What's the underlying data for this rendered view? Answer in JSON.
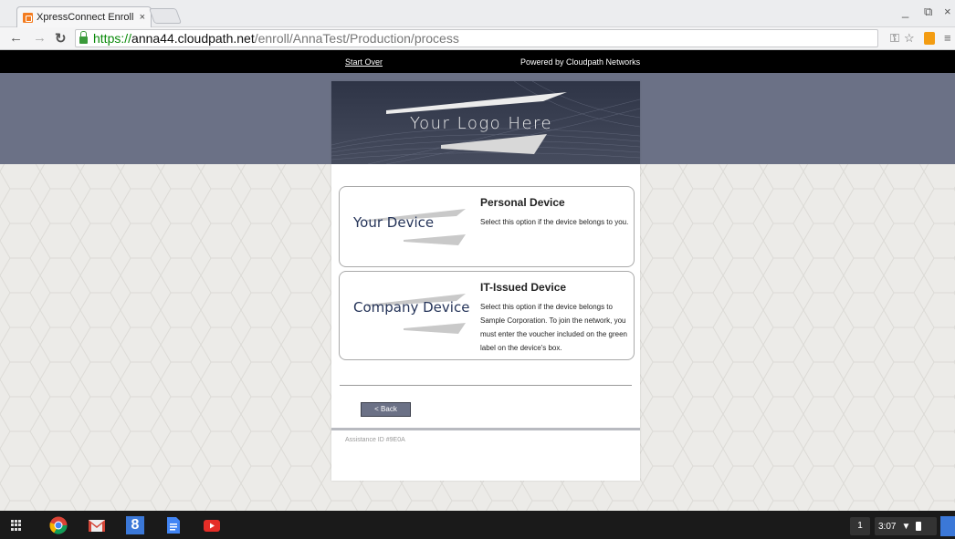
{
  "browser": {
    "tab_title": "XpressConnect Enrollme",
    "tab_close": "×",
    "url_scheme": "https://",
    "url_host": "anna44.cloudpath.net",
    "url_path": "/enroll/AnnaTest/Production/process",
    "window_controls": {
      "minimize": "_",
      "restore": "⧉",
      "close": "×"
    }
  },
  "nav": {
    "start_over": "Start Over",
    "powered_by": "Powered by Cloudpath Networks"
  },
  "banner": {
    "logo_text": "Your Logo Here"
  },
  "options": [
    {
      "graphic_label": "Your Device",
      "title": "Personal Device",
      "description": "Select this option if the device belongs to you."
    },
    {
      "graphic_label": "Company Device",
      "title": "IT-Issued Device",
      "description": "Select this option if the device belongs to Sample Corporation. To join the network, you must enter the voucher included on the green label on the device's box."
    }
  ],
  "back_button": "< Back",
  "assistance_id": "Assistance ID #9E0A",
  "taskbar": {
    "apps": [
      "chrome-icon",
      "gmail-icon",
      "google-plus-icon",
      "docs-icon",
      "youtube-icon"
    ],
    "notification_count": "1",
    "time": "3:07"
  },
  "colors": {
    "band": "#6b7186",
    "accent_url": "#0a8a0a",
    "card_border": "#a9a9a9",
    "graphic_text": "#26355a"
  }
}
